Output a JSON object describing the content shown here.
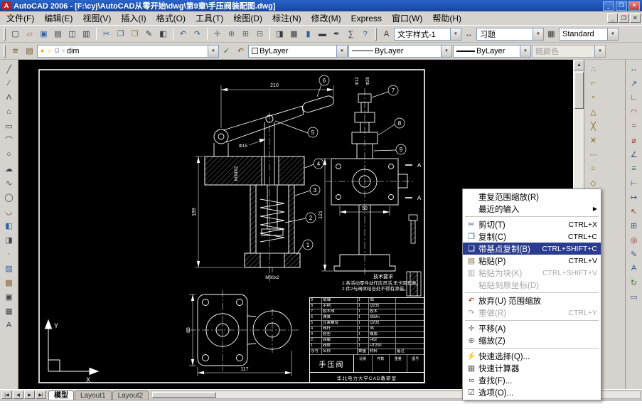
{
  "window": {
    "title": "AutoCAD 2006 - [F:\\cyj\\AutoCAD从零开始\\dwg\\第9章\\手压阀装配图.dwg]",
    "logo": "A",
    "controls": [
      {
        "name": "minimize-button",
        "glyph": "_"
      },
      {
        "name": "restore-button",
        "glyph": "❐"
      },
      {
        "name": "close-button",
        "glyph": "✕"
      }
    ]
  },
  "menubar": {
    "items": [
      "文件(F)",
      "编辑(E)",
      "视图(V)",
      "插入(I)",
      "格式(O)",
      "工具(T)",
      "绘图(D)",
      "标注(N)",
      "修改(M)",
      "Express",
      "窗口(W)",
      "帮助(H)"
    ],
    "mdi_controls": [
      {
        "name": "doc-minimize-button",
        "glyph": "_"
      },
      {
        "name": "doc-restore-button",
        "glyph": "❐"
      },
      {
        "name": "doc-close-button",
        "glyph": "✕"
      }
    ]
  },
  "standard_toolbar": {
    "icons": [
      {
        "name": "qnew-icon",
        "glyph": "▢"
      },
      {
        "name": "open-icon",
        "glyph": "▱",
        "color": "#8a6d3b"
      },
      {
        "name": "save-icon",
        "glyph": "▣",
        "color": "#2f5fa0"
      },
      {
        "name": "plot-icon",
        "glyph": "▤"
      },
      {
        "name": "plot-preview-icon",
        "glyph": "◫"
      },
      {
        "name": "publish-icon",
        "glyph": "▥"
      },
      {
        "sep": true
      },
      {
        "name": "cut-icon",
        "glyph": "✂",
        "color": "#2f5fa0"
      },
      {
        "name": "copy-icon",
        "glyph": "❐",
        "color": "#2f5fa0"
      },
      {
        "name": "paste-icon",
        "glyph": "❒",
        "color": "#8a6d3b"
      },
      {
        "name": "match-properties-icon",
        "glyph": "✎"
      },
      {
        "name": "block-editor-icon",
        "glyph": "◧"
      },
      {
        "sep": true
      },
      {
        "name": "undo-icon",
        "glyph": "↶",
        "color": "#2f5fa0"
      },
      {
        "name": "redo-icon",
        "glyph": "↷",
        "color": "#2f5fa0"
      },
      {
        "sep": true
      },
      {
        "name": "pan-icon",
        "glyph": "✛",
        "color": "#666666"
      },
      {
        "name": "zoom-realtime-icon",
        "glyph": "⊕",
        "color": "#666666"
      },
      {
        "name": "zoom-window-icon",
        "glyph": "⊞",
        "color": "#666666"
      },
      {
        "name": "zoom-previous-icon",
        "glyph": "⊟",
        "color": "#666666"
      },
      {
        "sep": true
      },
      {
        "name": "properties-icon",
        "glyph": "◨"
      },
      {
        "name": "designcenter-icon",
        "glyph": "▦"
      },
      {
        "name": "tool-palettes-icon",
        "glyph": "▮",
        "color": "#2f5fa0"
      },
      {
        "name": "sheet-set-manager-icon",
        "glyph": "▬"
      },
      {
        "name": "markup-icon",
        "glyph": "✒"
      },
      {
        "name": "quickcalc-icon",
        "glyph": "∑"
      },
      {
        "name": "help-icon",
        "glyph": "?",
        "color": "#2f5fa0"
      }
    ]
  },
  "styles_toolbar": {
    "text_style_icon": "A",
    "text_style": "文字样式-1",
    "dim_style_icon": "↔",
    "dim_style": "习题",
    "table_style_icon": "▦",
    "table_style": "Standard",
    "drop_glyph": "▼"
  },
  "properties_toolbar": {
    "left_icons": [
      {
        "name": "layer-properties-icon",
        "glyph": "≋",
        "color": "#6b5b2a"
      },
      {
        "name": "layer-states-manager-icon",
        "glyph": "▤",
        "color": "#6b5b2a"
      }
    ],
    "layer_state_icons": [
      {
        "name": "bulb-on-icon",
        "glyph": "●",
        "color": "#e8b400"
      },
      {
        "name": "sun-icon",
        "glyph": "☼",
        "color": "#e8b400"
      },
      {
        "name": "unlock-icon",
        "glyph": "Ω",
        "color": "#8a8a8a"
      },
      {
        "name": "layer-color-swatch-icon",
        "glyph": "■",
        "color": "#e0e0e0"
      }
    ],
    "layer": "dim",
    "mid_icons": [
      {
        "name": "make-object-layer-current-icon",
        "glyph": "✓",
        "color": "#2a7a2a"
      },
      {
        "name": "layer-previous-icon",
        "glyph": "↶",
        "color": "#6b5b2a"
      }
    ],
    "color_value": "ByLayer",
    "linetype_value": "ByLayer",
    "lineweight_value": "ByLayer",
    "plot_style_value": "随颜色",
    "drop_glyph": "▼"
  },
  "draw_toolbar": {
    "icons": [
      {
        "name": "line-icon",
        "glyph": "╱"
      },
      {
        "name": "construction-line-icon",
        "glyph": "∕"
      },
      {
        "name": "polyline-icon",
        "glyph": "Λ"
      },
      {
        "name": "polygon-icon",
        "glyph": "⌂"
      },
      {
        "name": "rectangle-icon",
        "glyph": "▭"
      },
      {
        "name": "arc-icon",
        "glyph": "⌒"
      },
      {
        "name": "circle-icon",
        "glyph": "○"
      },
      {
        "name": "revcloud-icon",
        "glyph": "☁"
      },
      {
        "name": "spline-icon",
        "glyph": "∿"
      },
      {
        "name": "ellipse-icon",
        "glyph": "◯"
      },
      {
        "name": "ellipse-arc-icon",
        "glyph": "◡"
      },
      {
        "name": "insert-block-icon",
        "glyph": "◧",
        "color": "#2f5fa0"
      },
      {
        "name": "make-block-icon",
        "glyph": "◨"
      },
      {
        "name": "point-icon",
        "glyph": "·"
      },
      {
        "name": "hatch-icon",
        "glyph": "▨",
        "color": "#2f5fa0"
      },
      {
        "name": "gradient-icon",
        "glyph": "▩",
        "color": "#8a6d3b"
      },
      {
        "name": "region-icon",
        "glyph": "▣"
      },
      {
        "name": "table-icon",
        "glyph": "▦"
      },
      {
        "name": "multiline-text-icon",
        "glyph": "A"
      }
    ]
  },
  "osnap_toolbar": {
    "icons": [
      {
        "name": "temporary-track-point-icon",
        "glyph": "∴",
        "color": "#7a6a20"
      },
      {
        "name": "snap-from-icon",
        "glyph": "⌐",
        "color": "#7a6a20"
      },
      {
        "name": "snap-endpoint-icon",
        "glyph": "▫",
        "color": "#7a6a20"
      },
      {
        "name": "snap-midpoint-icon",
        "glyph": "△",
        "color": "#7a6a20"
      },
      {
        "name": "snap-intersection-icon",
        "glyph": "╳",
        "color": "#7a6a20"
      },
      {
        "name": "snap-apparent-intersection-icon",
        "glyph": "✕",
        "color": "#7a6a20"
      },
      {
        "name": "snap-extension-icon",
        "glyph": "⋯",
        "color": "#7a6a20"
      },
      {
        "name": "snap-center-icon",
        "glyph": "○",
        "color": "#7a6a20"
      },
      {
        "name": "snap-quadrant-icon",
        "glyph": "◇",
        "color": "#7a6a20"
      },
      {
        "name": "snap-tangent-icon",
        "glyph": "⊙",
        "color": "#7a6a20"
      },
      {
        "name": "snap-perpendicular-icon",
        "glyph": "⊥",
        "color": "#7a6a20"
      },
      {
        "name": "snap-parallel-icon",
        "glyph": "∥",
        "color": "#7a6a20"
      },
      {
        "name": "snap-insert-icon",
        "glyph": "▣",
        "color": "#7a6a20"
      },
      {
        "name": "snap-node-icon",
        "glyph": "◎",
        "color": "#7a6a20"
      },
      {
        "name": "snap-nearest-icon",
        "glyph": "≈",
        "color": "#7a6a20"
      },
      {
        "name": "snap-none-icon",
        "glyph": "∅",
        "color": "#7a6a20"
      },
      {
        "name": "osnap-settings-icon",
        "glyph": "∗",
        "color": "#7a6a20"
      }
    ]
  },
  "dimension_toolbar": {
    "icons": [
      {
        "name": "dim-linear-icon",
        "glyph": "↔",
        "color": "#33548c"
      },
      {
        "name": "dim-aligned-icon",
        "glyph": "↗",
        "color": "#33548c"
      },
      {
        "name": "dim-ordinate-icon",
        "glyph": "∟",
        "color": "#33548c"
      },
      {
        "name": "dim-radius-icon",
        "glyph": "◠",
        "color": "#993333"
      },
      {
        "name": "dim-jogged-icon",
        "glyph": "≈",
        "color": "#993333"
      },
      {
        "name": "dim-diameter-icon",
        "glyph": "⌀",
        "color": "#993333"
      },
      {
        "name": "dim-angular-icon",
        "glyph": "∠",
        "color": "#33548c"
      },
      {
        "name": "quick-dimension-icon",
        "glyph": "≡",
        "color": "#2a7a2a"
      },
      {
        "name": "dim-baseline-icon",
        "glyph": "⊢",
        "color": "#33548c"
      },
      {
        "name": "dim-continue-icon",
        "glyph": "↦",
        "color": "#33548c"
      },
      {
        "name": "quick-leader-icon",
        "glyph": "↖",
        "color": "#993333"
      },
      {
        "name": "tolerance-icon",
        "glyph": "⊞",
        "color": "#33548c"
      },
      {
        "name": "center-mark-icon",
        "glyph": "◎",
        "color": "#993333"
      },
      {
        "name": "dimension-edit-icon",
        "glyph": "✎",
        "color": "#33548c"
      },
      {
        "name": "dimension-text-edit-icon",
        "glyph": "A",
        "color": "#33548c"
      },
      {
        "name": "dimension-update-icon",
        "glyph": "↻",
        "color": "#2a7a2a"
      },
      {
        "name": "dimension-style-icon",
        "glyph": "▭",
        "color": "#33548c"
      }
    ]
  },
  "scrollbars": {
    "up": "▲",
    "down": "▼"
  },
  "tabbar": {
    "nav": [
      {
        "name": "first-tab-button",
        "glyph": "|◀"
      },
      {
        "name": "prev-tab-button",
        "glyph": "◀"
      },
      {
        "name": "next-tab-button",
        "glyph": "▶"
      },
      {
        "name": "last-tab-button",
        "glyph": "▶|"
      }
    ],
    "tabs": [
      {
        "label": "模型",
        "active": true
      },
      {
        "label": "Layout1"
      },
      {
        "label": "Layout2"
      }
    ]
  },
  "context_menu": {
    "submenu_arrow": "▶",
    "items": [
      {
        "label": "重复范围缩放(R)",
        "shortcut": "",
        "glyph": ""
      },
      {
        "label": "最近的输入",
        "shortcut": "",
        "glyph": "",
        "submenu": true
      },
      {
        "sep": true
      },
      {
        "label": "剪切(T)",
        "shortcut": "CTRL+X",
        "glyph": "✂",
        "color": "#2f5fa0"
      },
      {
        "label": "复制(C)",
        "shortcut": "CTRL+C",
        "glyph": "❐",
        "color": "#2f5fa0"
      },
      {
        "label": "带基点复制(B)",
        "shortcut": "CTRL+SHIFT+C",
        "glyph": "❑",
        "highlighted": true
      },
      {
        "label": "粘贴(P)",
        "shortcut": "CTRL+V",
        "glyph": "▤",
        "color": "#8a6d3b"
      },
      {
        "label": "粘贴为块(K)",
        "shortcut": "CTRL+SHIFT+V",
        "glyph": "▥",
        "disabled": true
      },
      {
        "label": "粘贴到原坐标(D)",
        "shortcut": "",
        "glyph": "",
        "disabled": true
      },
      {
        "sep": true
      },
      {
        "label": "放弃(U) 范围缩放",
        "shortcut": "",
        "glyph": "↶",
        "color": "#b03030"
      },
      {
        "label": "重做(R)",
        "shortcut": "CTRL+Y",
        "glyph": "↷",
        "disabled": true
      },
      {
        "sep": true
      },
      {
        "label": "平移(A)",
        "shortcut": "",
        "glyph": "✛",
        "color": "#666666"
      },
      {
        "label": "缩放(Z)",
        "shortcut": "",
        "glyph": "⊕",
        "color": "#666666"
      },
      {
        "sep": true
      },
      {
        "label": "快速选择(Q)...",
        "shortcut": "",
        "glyph": "⚡",
        "color": "#b08d00"
      },
      {
        "label": "快速计算器",
        "shortcut": "",
        "glyph": "▦",
        "color": "#666666"
      },
      {
        "label": "查找(F)...",
        "shortcut": "",
        "glyph": "∞",
        "color": "#444444"
      },
      {
        "label": "选项(O)...",
        "shortcut": "",
        "glyph": "☑",
        "color": "#444444"
      }
    ]
  },
  "drawing": {
    "dims": {
      "len210": "210",
      "len189": "189",
      "len121": "121",
      "len50": "50",
      "len117": "117",
      "len85": "85",
      "phi15": "Φ15",
      "m30x2_upper": "M30X2",
      "m30x2_lower": "M30x2",
      "phi12": "Φ12",
      "phi28": "Φ28",
      "section": "A"
    },
    "balloons": [
      "1",
      "2",
      "3",
      "4",
      "5",
      "6",
      "7",
      "8",
      "9"
    ],
    "ucs": {
      "x": "X",
      "y": "Y"
    },
    "notes": {
      "title": "技术要求",
      "line1": "1.各活动零件动作应灵活,无卡阻现象。",
      "line2": "2.件2与阀体结合处不得有渗漏。"
    },
    "parts_table": {
      "headers": [
        "序号",
        "名称",
        "数量",
        "材料",
        "备注"
      ],
      "rows": [
        [
          "1",
          "阀体",
          "1",
          "HT200",
          ""
        ],
        [
          "2",
          "阀瓣",
          "1",
          "H62",
          ""
        ],
        [
          "3",
          "胶垫",
          "1",
          "橡胶",
          ""
        ],
        [
          "4",
          "阀杆",
          "1",
          "35",
          ""
        ],
        [
          "5",
          "压紧螺母",
          "1",
          "Q235",
          ""
        ],
        [
          "6",
          "弹簧",
          "1",
          "65Mn",
          ""
        ],
        [
          "7",
          "胶木球",
          "1",
          "胶木",
          ""
        ],
        [
          "8",
          "手柄",
          "1",
          "Q235",
          ""
        ],
        [
          "9",
          "销轴",
          "1",
          "35",
          ""
        ]
      ],
      "title_block": {
        "title": "手压阀",
        "fields": [
          "比例",
          "件数",
          "重量",
          "图号"
        ],
        "org": "华北电力大学CAD教研室"
      }
    }
  }
}
